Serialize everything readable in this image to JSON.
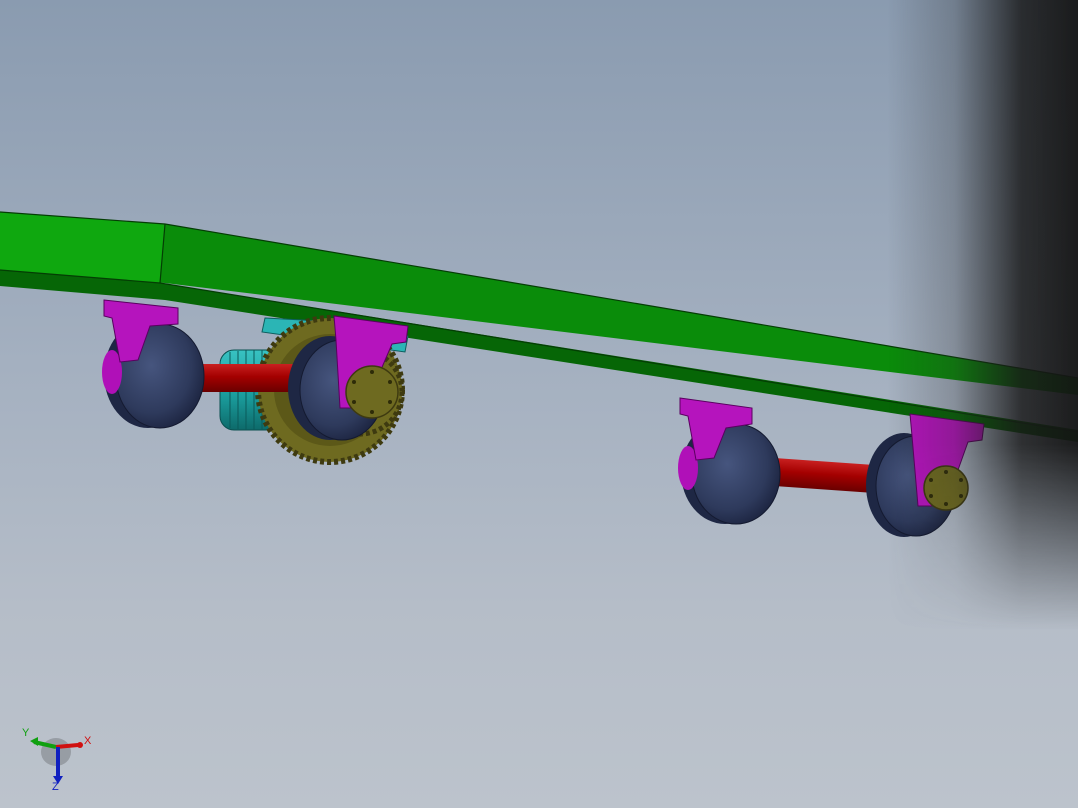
{
  "triad": {
    "x_label": "X",
    "y_label": "Y",
    "z_label": "Z",
    "x_color": "#d01010",
    "y_color": "#10a010",
    "z_color": "#1020c0"
  },
  "colors": {
    "platform": "#0a8a0a",
    "platform_dark": "#056205",
    "bracket": "#b010b8",
    "wheel": "#2e3a5c",
    "axle": "#b00000",
    "motor": "#20a8a8",
    "gear": "#6e6a20",
    "background_top": "#8a9bb0",
    "background_bottom": "#bcc3cc"
  }
}
